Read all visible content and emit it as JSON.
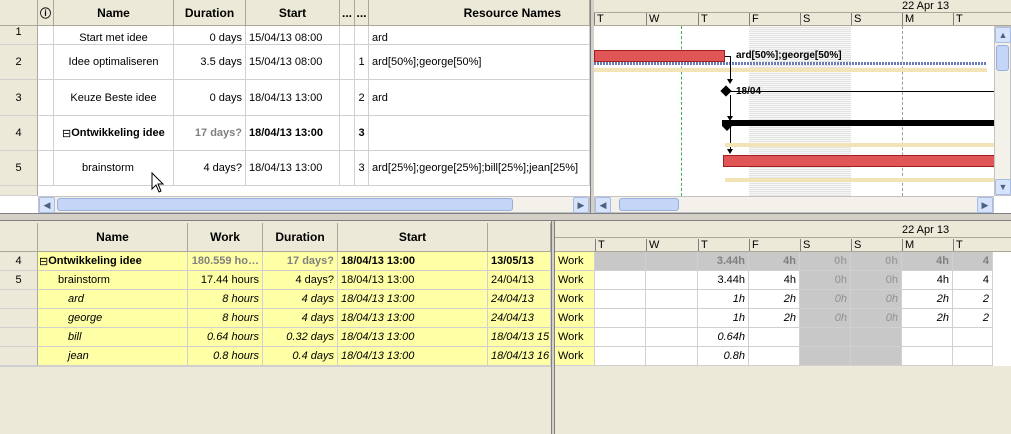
{
  "top_table": {
    "headers": {
      "info": "ⓘ",
      "name": "Name",
      "duration": "Duration",
      "start": "Start",
      "col1": "...",
      "col2": "...",
      "resources": "Resource Names"
    },
    "rows": [
      {
        "id": "1",
        "name": "Start met idee",
        "duration": "0 days",
        "start": "15/04/13 08:00",
        "c1": "",
        "c2": "",
        "resources": "ard"
      },
      {
        "id": "2",
        "name": "Idee optimaliseren",
        "duration": "3.5 days",
        "start": "15/04/13 08:00",
        "c1": "",
        "c2": "1",
        "resources": "ard[50%];george[50%]"
      },
      {
        "id": "3",
        "name": "Keuze Beste idee",
        "duration": "0 days",
        "start": "18/04/13 13:00",
        "c1": "",
        "c2": "2",
        "resources": "ard"
      },
      {
        "id": "4",
        "name": "Ontwikkeling idee",
        "duration": "17 days?",
        "start": "18/04/13 13:00",
        "c1": "",
        "c2": "3",
        "resources": "",
        "expander": "⊟"
      },
      {
        "id": "5",
        "name": "brainstorm",
        "duration": "4 days?",
        "start": "18/04/13 13:00",
        "c1": "",
        "c2": "3",
        "resources": "ard[25%];george[25%];bill[25%];jean[25%]"
      }
    ]
  },
  "top_gantt": {
    "week_label": "22 Apr 13",
    "days": [
      "T",
      "W",
      "T",
      "F",
      "S",
      "S",
      "M",
      "T"
    ],
    "bar_label_2": "ard[50%];george[50%]",
    "milestone_label": "18/04"
  },
  "bottom_table": {
    "headers": {
      "name": "Name",
      "work": "Work",
      "duration": "Duration",
      "start": "Start"
    },
    "rows": [
      {
        "id": "4",
        "name": "Ontwikkeling idee",
        "work": "180.559 ho…",
        "duration": "17 days?",
        "start": "18/04/13 13:00",
        "finish": "13/05/13",
        "expander": "⊟"
      },
      {
        "id": "5",
        "name": "brainstorm",
        "work": "17.44 hours",
        "duration": "4 days?",
        "start": "18/04/13 13:00",
        "finish": "24/04/13"
      },
      {
        "id": "",
        "name": "ard",
        "work": "8 hours",
        "duration": "4 days",
        "start": "18/04/13 13:00",
        "finish": "24/04/13"
      },
      {
        "id": "",
        "name": "george",
        "work": "8 hours",
        "duration": "4 days",
        "start": "18/04/13 13:00",
        "finish": "24/04/13"
      },
      {
        "id": "",
        "name": "bill",
        "work": "0.64 hours",
        "duration": "0.32 days",
        "start": "18/04/13 13:00",
        "finish": "18/04/13 15"
      },
      {
        "id": "",
        "name": "jean",
        "work": "0.8 hours",
        "duration": "0.4 days",
        "start": "18/04/13 13:00",
        "finish": "18/04/13 16"
      }
    ]
  },
  "bottom_grid": {
    "week_label": "22 Apr 13",
    "days": [
      "T",
      "W",
      "T",
      "F",
      "S",
      "S",
      "M",
      "T"
    ],
    "rows": [
      {
        "label": "Work",
        "vals": [
          "",
          "",
          "3.44h",
          "4h",
          "0h",
          "0h",
          "4h",
          "4"
        ]
      },
      {
        "label": "Work",
        "vals": [
          "",
          "",
          "3.44h",
          "4h",
          "0h",
          "0h",
          "4h",
          "4"
        ]
      },
      {
        "label": "Work",
        "vals": [
          "",
          "",
          "1h",
          "2h",
          "0h",
          "0h",
          "2h",
          "2"
        ]
      },
      {
        "label": "Work",
        "vals": [
          "",
          "",
          "1h",
          "2h",
          "0h",
          "0h",
          "2h",
          "2"
        ]
      },
      {
        "label": "Work",
        "vals": [
          "",
          "",
          "0.64h",
          "",
          "",
          "",
          "",
          ""
        ]
      },
      {
        "label": "Work",
        "vals": [
          "",
          "",
          "0.8h",
          "",
          "",
          "",
          "",
          ""
        ]
      }
    ]
  }
}
